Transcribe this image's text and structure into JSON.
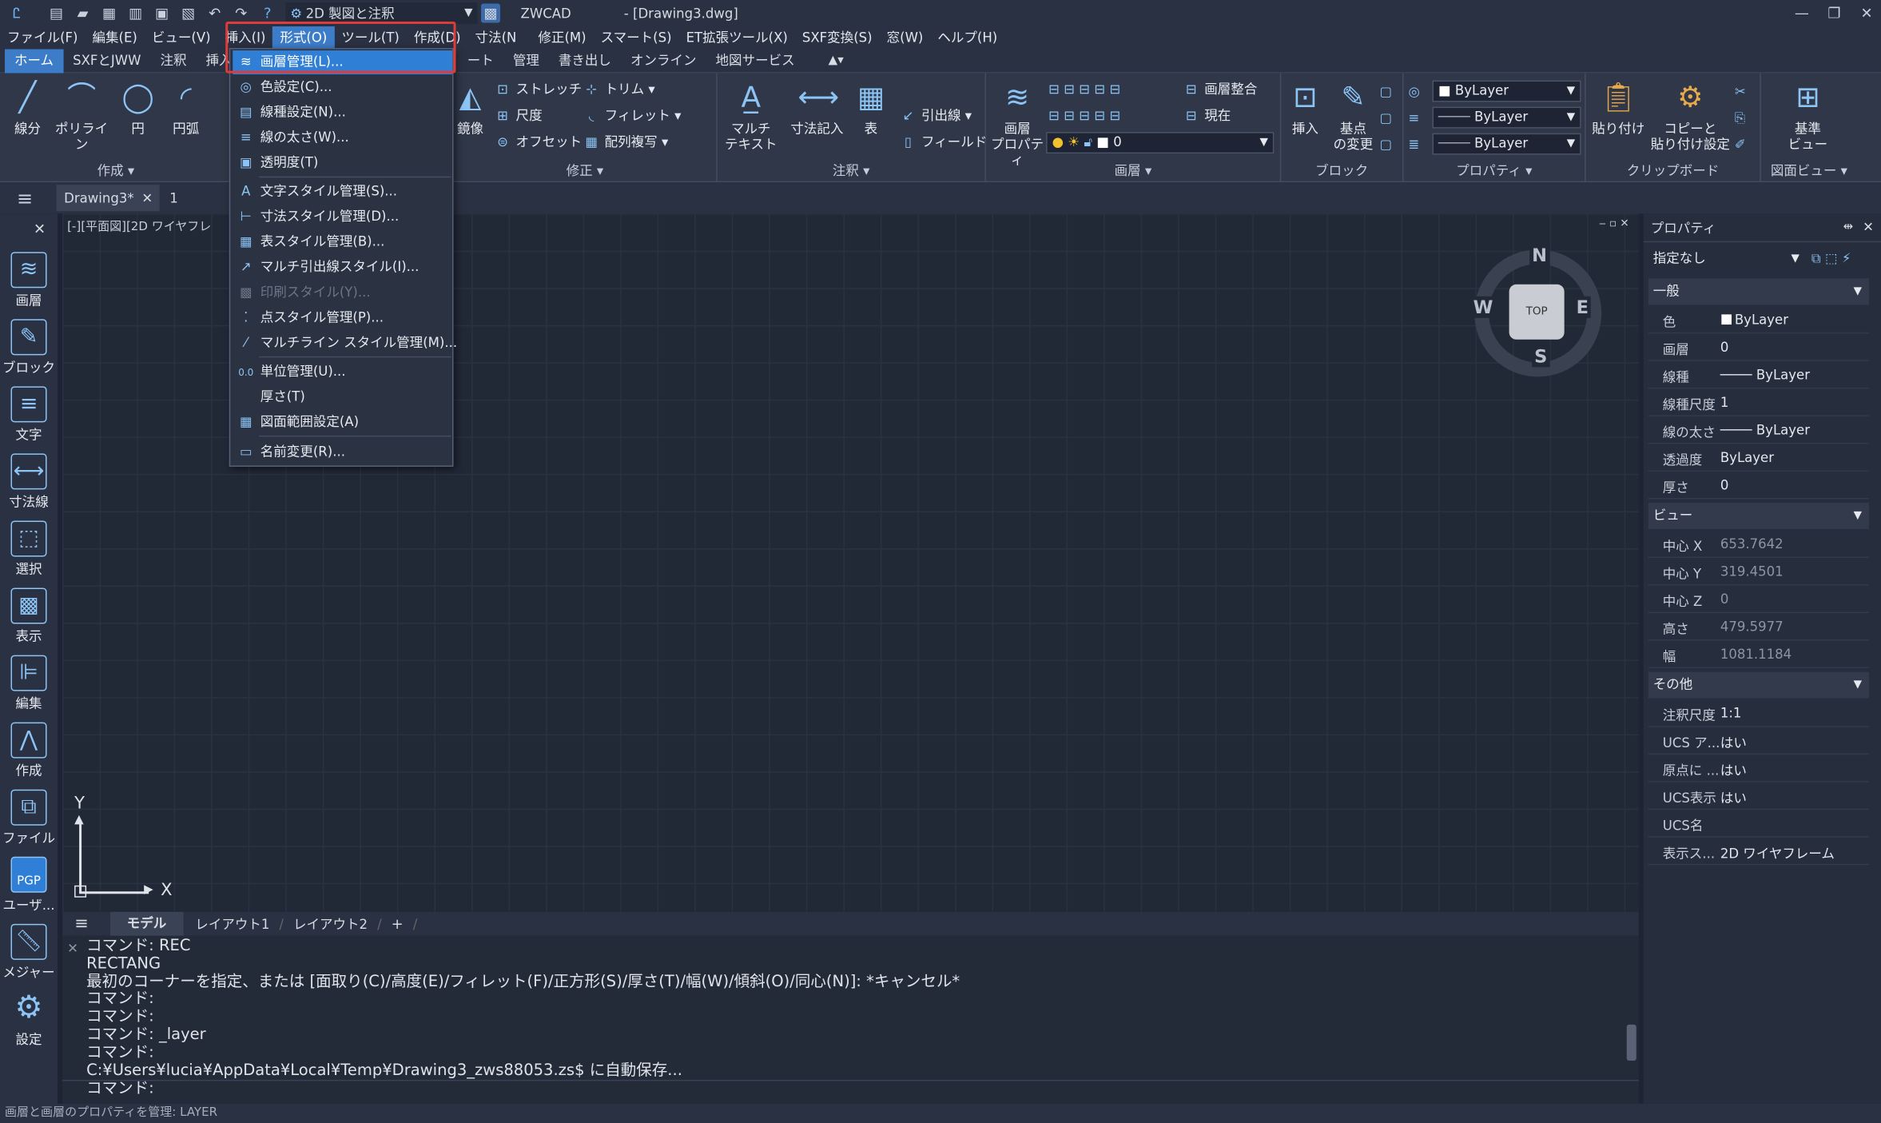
{
  "titlebar": {
    "workspace": "2D 製図と注釈",
    "title": "ZWCAD",
    "doc": "- [Drawing3.dwg]"
  },
  "menubar": [
    "ファイル(F)",
    "編集(E)",
    "ビュー(V)",
    "挿入(I)",
    "形式(O)",
    "ツール(T)",
    "作成(D)",
    "寸法(N",
    "修正(M)",
    "スマート(S)",
    "ET拡張ツール(X)",
    "SXF変換(S)",
    "窓(W)",
    "ヘルプ(H)"
  ],
  "ribbon_tabs": [
    "ホーム",
    "SXFとJWW",
    "注釈",
    "挿入",
    "ート",
    "管理",
    "書き出し",
    "オンライン",
    "地図サービス"
  ],
  "ribbon": {
    "draw": {
      "line": "線分",
      "polyline": "ポリライン",
      "circle": "円",
      "arc": "円弧",
      "label": "作成"
    },
    "modify": {
      "mirror": "鏡像",
      "stretch": "ストレッチ",
      "scale": "尺度",
      "offset": "オフセット",
      "trim": "トリム",
      "fillet": "フィレット",
      "array": "配列複写",
      "label": "修正"
    },
    "annotation": {
      "mtext1": "マルチ",
      "mtext2": "テキスト",
      "dim": "寸法記入",
      "table": "表",
      "leader": "引出線",
      "field": "フィールド",
      "label": "注釈"
    },
    "layers": {
      "props1": "画層",
      "props2": "プロパティ",
      "match": "画層整合",
      "current": "現在",
      "layer_value": "0",
      "label": "画層"
    },
    "block": {
      "insert": "挿入",
      "base1": "基点",
      "base2": "の変更",
      "label": "ブロック"
    },
    "properties": {
      "color": "ByLayer",
      "linetype": "ByLayer",
      "lineweight": "ByLayer",
      "label": "プロパティ"
    },
    "clipboard": {
      "paste": "貼り付け",
      "copy1": "コピーと",
      "copy2": "貼り付け設定",
      "label": "クリップボード"
    },
    "views": {
      "v1": "基準",
      "v2": "ビュー",
      "label": "図面ビュー"
    }
  },
  "doctabs": {
    "tab1": "Drawing3*",
    "tab2": "1"
  },
  "viewport_label": "[-][平面図][2D ワイヤフレ",
  "lefttoolbar": [
    "画層",
    "ブロック",
    "文字",
    "寸法線",
    "選択",
    "表示",
    "編集",
    "作成",
    "ファイル",
    "ユーザ...",
    "メジャー",
    "設定"
  ],
  "pgp": "PGP",
  "viewcube": {
    "n": "N",
    "s": "S",
    "e": "E",
    "w": "W",
    "top": "TOP"
  },
  "ucs": {
    "x": "X",
    "y": "Y"
  },
  "layout_tabs": [
    "モデル",
    "レイアウト1",
    "レイアウト2",
    "+"
  ],
  "command_lines": [
    "コマンド: REC",
    "RECTANG",
    "最初のコーナーを指定、または [面取り(C)/高度(E)/フィレット(F)/正方形(S)/厚さ(T)/幅(W)/傾斜(O)/同心(N)]: *キャンセル*",
    "コマンド:",
    "コマンド:",
    "コマンド: _layer",
    "コマンド:",
    "C:¥Users¥lucia¥AppData¥Local¥Temp¥Drawing3_zws88053.zs$ に自動保存...",
    "コマンド:"
  ],
  "status": "画層と画層のプロパティを管理: LAYER",
  "properties": {
    "title": "プロパティ",
    "selection": "指定なし",
    "sections": [
      {
        "name": "一般",
        "rows": [
          [
            "色",
            "ByLayer"
          ],
          [
            "画層",
            "0"
          ],
          [
            "線種",
            "──── ByLayer"
          ],
          [
            "線種尺度",
            "1"
          ],
          [
            "線の太さ",
            "──── ByLayer"
          ],
          [
            "透過度",
            "ByLayer"
          ],
          [
            "厚さ",
            "0"
          ]
        ]
      },
      {
        "name": "ビュー",
        "rows": [
          [
            "中心 X",
            "653.7642"
          ],
          [
            "中心 Y",
            "319.4501"
          ],
          [
            "中心 Z",
            "0"
          ],
          [
            "高さ",
            "479.5977"
          ],
          [
            "幅",
            "1081.1184"
          ]
        ]
      },
      {
        "name": "その他",
        "rows": [
          [
            "注釈尺度",
            "1:1"
          ],
          [
            "UCS ア...",
            "はい"
          ],
          [
            "原点に ...",
            "はい"
          ],
          [
            "UCS表示",
            "はい"
          ],
          [
            "UCS名",
            ""
          ],
          [
            "表示ス...",
            "2D ワイヤフレーム"
          ]
        ]
      }
    ]
  },
  "dropdown": [
    {
      "label": "画層管理(L)...",
      "icon": "layers-icon",
      "highlighted": true
    },
    {
      "label": "色設定(C)...",
      "icon": "color-icon"
    },
    {
      "label": "線種設定(N)...",
      "icon": "linetype-icon"
    },
    {
      "label": "線の太さ(W)...",
      "icon": "lineweight-icon"
    },
    {
      "label": "透明度(T)",
      "icon": "transparency-icon"
    },
    {
      "label": "文字スタイル管理(S)...",
      "icon": "textstyle-icon"
    },
    {
      "label": "寸法スタイル管理(D)...",
      "icon": "dimstyle-icon"
    },
    {
      "label": "表スタイル管理(B)...",
      "icon": "tablestyle-icon"
    },
    {
      "label": "マルチ引出線スタイル(I)...",
      "icon": "mleader-icon"
    },
    {
      "label": "印刷スタイル(Y)...",
      "icon": "plotstyle-icon",
      "disabled": true
    },
    {
      "label": "点スタイル管理(P)...",
      "icon": "pointstyle-icon"
    },
    {
      "label": "マルチライン スタイル管理(M)...",
      "icon": "mlstyle-icon"
    },
    {
      "label": "単位管理(U)...",
      "icon": "units-icon"
    },
    {
      "label": "厚さ(T)",
      "icon": ""
    },
    {
      "label": "図面範囲設定(A)",
      "icon": "limits-icon"
    },
    {
      "label": "名前変更(R)...",
      "icon": "rename-icon"
    }
  ]
}
